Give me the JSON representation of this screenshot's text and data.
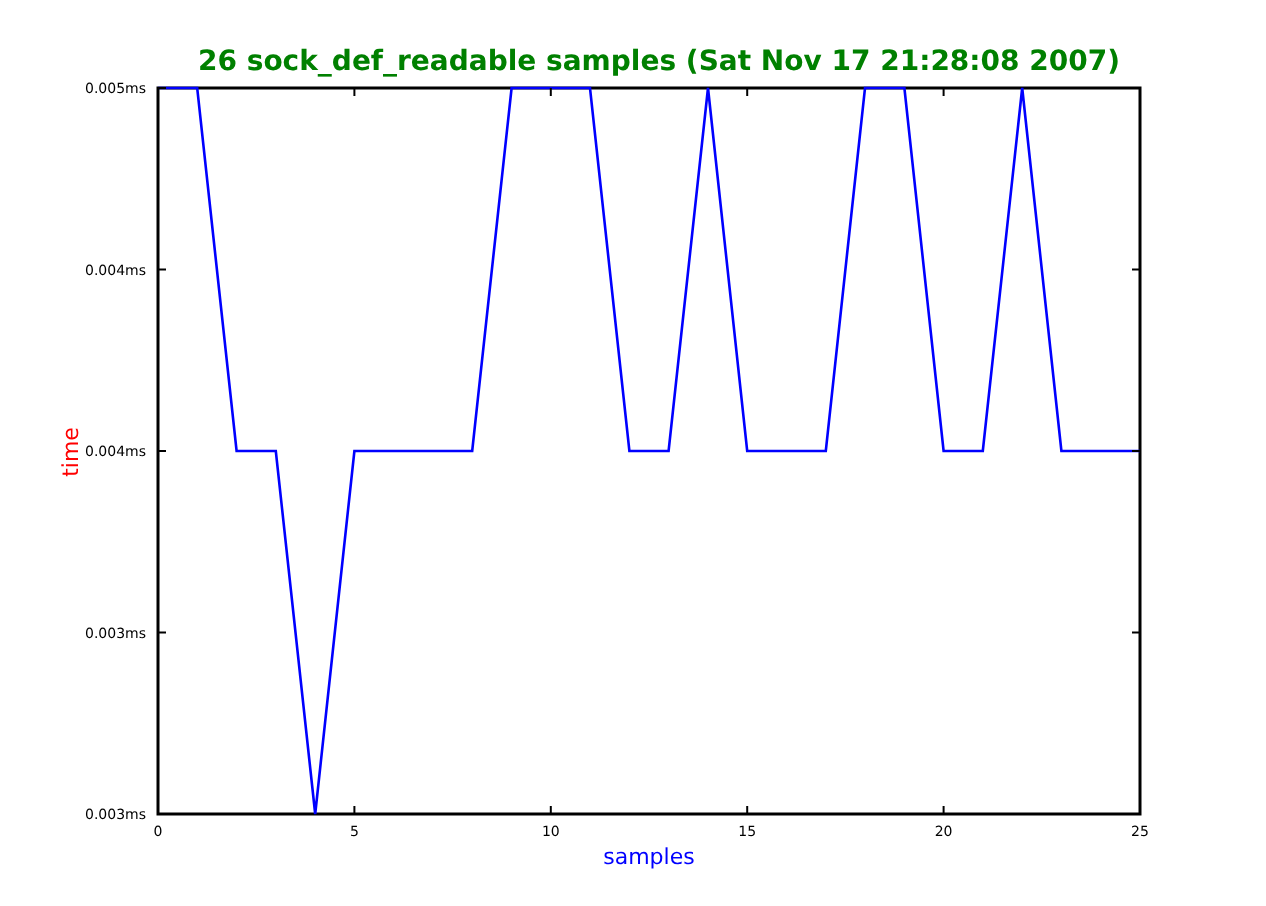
{
  "chart_data": {
    "type": "line",
    "title": "26 sock_def_readable samples (Sat Nov 17 21:28:08 2007)",
    "xlabel": "samples",
    "ylabel": "time",
    "x": [
      0,
      1,
      2,
      3,
      4,
      5,
      6,
      7,
      8,
      9,
      10,
      11,
      12,
      13,
      14,
      15,
      16,
      17,
      18,
      19,
      20,
      21,
      22,
      23,
      24,
      25
    ],
    "series": [
      {
        "color": "#0000ff",
        "values": [
          0.005,
          0.005,
          0.004,
          0.004,
          0.003,
          0.004,
          0.004,
          0.004,
          0.004,
          0.005,
          0.005,
          0.005,
          0.004,
          0.004,
          0.005,
          0.004,
          0.004,
          0.004,
          0.005,
          0.005,
          0.004,
          0.004,
          0.005,
          0.004,
          0.004,
          0.004
        ]
      }
    ],
    "xlim": [
      0,
      25
    ],
    "ylim": [
      0.003,
      0.005
    ],
    "xticks": [
      0,
      5,
      10,
      15,
      20,
      25
    ],
    "yticks": [
      {
        "value": 0.003,
        "label": "0.003ms"
      },
      {
        "value": 0.0035,
        "label": "0.003ms"
      },
      {
        "value": 0.004,
        "label": "0.004ms"
      },
      {
        "value": 0.0045,
        "label": "0.004ms"
      },
      {
        "value": 0.005,
        "label": "0.005ms"
      }
    ]
  }
}
